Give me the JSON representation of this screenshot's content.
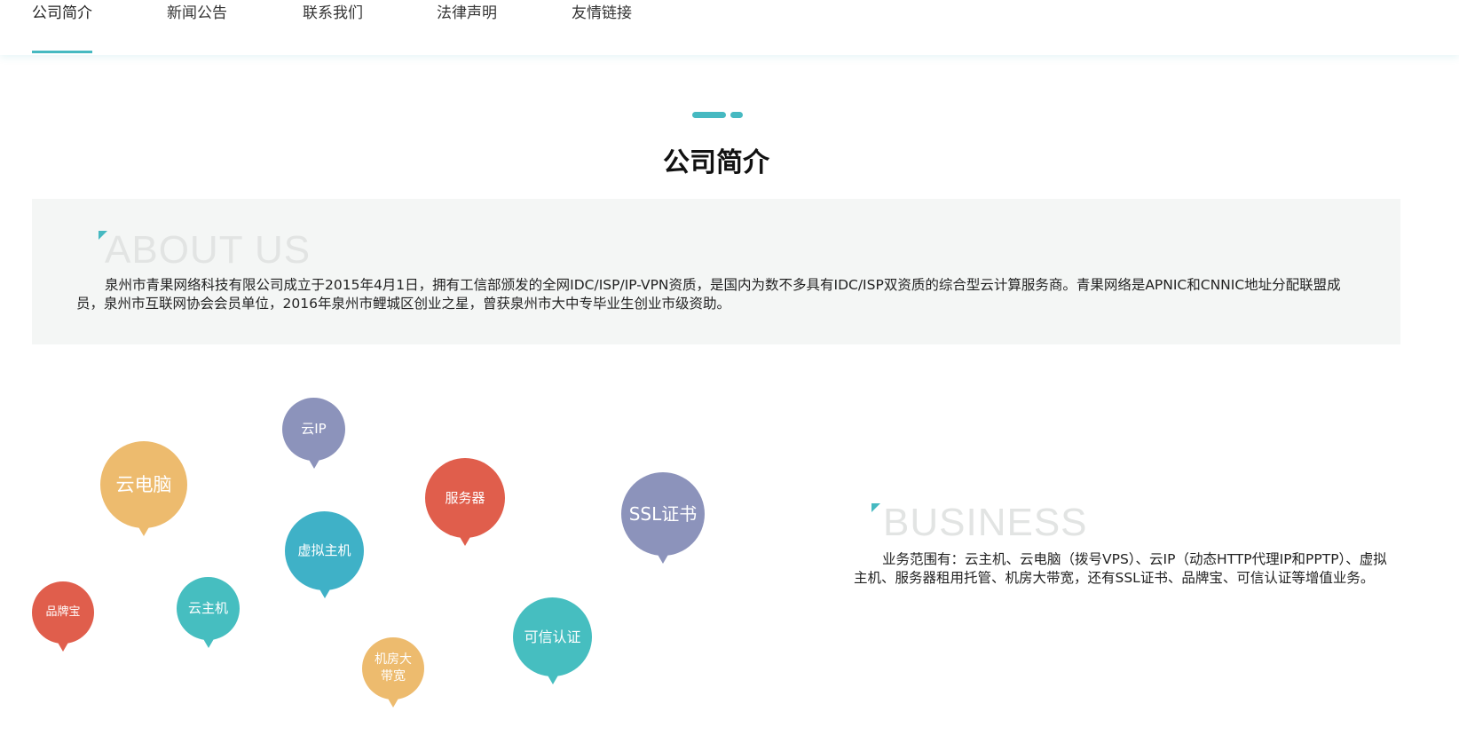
{
  "nav": {
    "items": [
      {
        "label": "公司简介",
        "active": true
      },
      {
        "label": "新闻公告",
        "active": false
      },
      {
        "label": "联系我们",
        "active": false
      },
      {
        "label": "法律声明",
        "active": false
      },
      {
        "label": "友情链接",
        "active": false
      }
    ]
  },
  "section": {
    "title": "公司简介"
  },
  "about": {
    "heading": "ABOUT US",
    "text": "泉州市青果网络科技有限公司成立于2015年4月1日，拥有工信部颁发的全网IDC/ISP/IP-VPN资质，是国内为数不多具有IDC/ISP双资质的综合型云计算服务商。青果网络是APNIC和CNNIC地址分配联盟成员，泉州市互联网协会会员单位，2016年泉州市鲤城区创业之星，曾获泉州市大中专毕业生创业市级资助。"
  },
  "bubbles": [
    {
      "label": "云IP",
      "color": "#8c93bb"
    },
    {
      "label": "云电脑",
      "color": "#edbb6e"
    },
    {
      "label": "服务器",
      "color": "#e05e4c"
    },
    {
      "label": "SSL证书",
      "color": "#8c93bb"
    },
    {
      "label": "虚拟主机",
      "color": "#3fb1c7"
    },
    {
      "label": "品牌宝",
      "color": "#e05e4c"
    },
    {
      "label": "云主机",
      "color": "#46bec0"
    },
    {
      "label": "可信认证",
      "color": "#46bec0"
    },
    {
      "label": "机房大带宽",
      "color": "#edbb6e"
    }
  ],
  "business": {
    "heading": "BUSINESS",
    "text": "业务范围有：云主机、云电脑（拨号VPS）、云IP（动态HTTP代理IP和PPTP）、虚拟主机、服务器租用托管、机房大带宽，还有SSL证书、品牌宝、可信认证等增值业务。"
  },
  "colors": {
    "accent": "#46b9c1",
    "panel": "#f4f6f5"
  }
}
